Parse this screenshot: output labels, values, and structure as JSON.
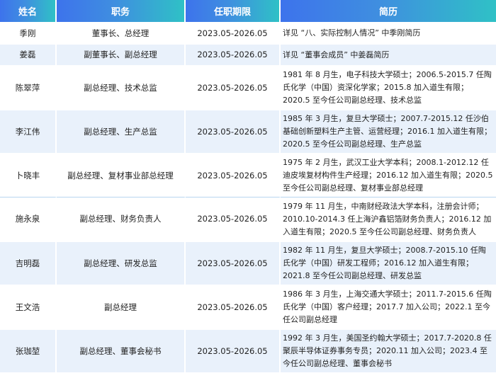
{
  "headers": [
    "姓名",
    "职务",
    "任职期限",
    "简历"
  ],
  "rows": [
    {
      "name": "季刚",
      "title": "董事长、总经理",
      "term": "2023.05-2026.05",
      "bio": "详见 “八、实际控制人情况” 中季刚简历"
    },
    {
      "name": "姜磊",
      "title": "副董事长、副总经理",
      "term": "2023.05-2026.05",
      "bio": "详见 “董事会成员” 中姜磊简历"
    },
    {
      "name": "陈翠萍",
      "title": "副总经理、技术总监",
      "term": "2023.05-2026.05",
      "bio": "1981 年 8 月生，电子科技大学硕士；2006.5-2015.7 任陶氏化学（中国）资深化学家；2015.8 加入道生有限；2020.5 至今任公司副总经理、技术总监"
    },
    {
      "name": "李江伟",
      "title": "副总经理、生产总监",
      "term": "2023.05-2026.05",
      "bio": "1985 年 3 月生，复旦大学硕士；2007.7-2015.12 任沙伯基础创新塑料生产主管、运营经理；2016.1 加入道生有限；2020.5 至今任公司副总经理、生产总监"
    },
    {
      "name": "卜晓丰",
      "title": "副总经理、复材事业部总经理",
      "term": "2023.05-2026.05",
      "bio": "1975 年 2 月生，武汉工业大学本科；2008.1-2012.12 任迪皮埃复材构件生产经理；2016.12 加入道生有限；2020.5 至今任公司副总经理、复材事业部总经理"
    },
    {
      "name": "施永泉",
      "title": "副总经理、财务负责人",
      "term": "2023.05-2026.05",
      "bio": "1979 年 11 月生，中南财经政法大学本科，注册会计师；2010.10-2014.3 任上海沪鑫铝箔财务负责人；2016.12 加入道生有限；2020.5 至今任公司副总经理、财务负责人"
    },
    {
      "name": "吉明磊",
      "title": "副总经理、研发总监",
      "term": "2023.05-2026.05",
      "bio": "1982 年 11 月生，复旦大学硕士；2008.7-2015.10 任陶氏化学（中国）研发工程师；2016.12 加入道生有限；2021.8 至今任公司副总经理、研发总监"
    },
    {
      "name": "王文浩",
      "title": "副总经理",
      "term": "2023.05-2026.05",
      "bio": "1986 年 3 月生，上海交通大学硕士；2011.7-2015.6 任陶氏化学（中国）客户经理；2017.7 加入公司；2022.1 至今任公司副总经理"
    },
    {
      "name": "张珈堃",
      "title": "副总经理、董事会秘书",
      "term": "2023.05-2026.05",
      "bio": "1992 年 3 月生，美国圣约翰大学硕士；2017.7-2020.8 任聚辰半导体证券事务专员；2020.11 加入公司；2023.4 至今任公司副总经理、董事会秘书"
    }
  ]
}
